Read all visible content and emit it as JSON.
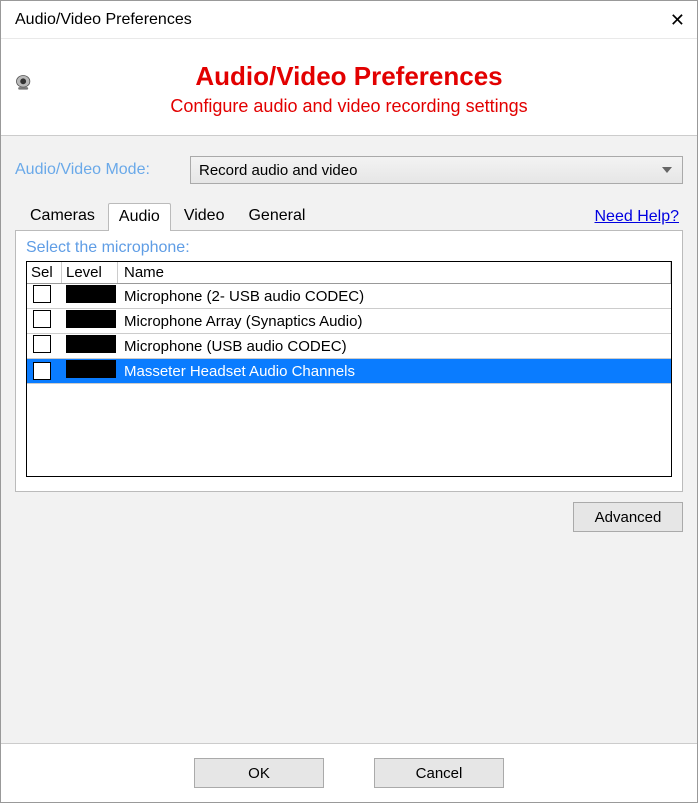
{
  "window": {
    "title": "Audio/Video Preferences"
  },
  "header": {
    "title": "Audio/Video Preferences",
    "subtitle": "Configure audio and video recording settings"
  },
  "mode": {
    "label": "Audio/Video Mode:",
    "value": "Record audio and video"
  },
  "tabs": [
    {
      "label": "Cameras",
      "active": false
    },
    {
      "label": "Audio",
      "active": true
    },
    {
      "label": "Video",
      "active": false
    },
    {
      "label": "General",
      "active": false
    }
  ],
  "helpLink": "Need Help?",
  "micSection": {
    "label": "Select the microphone:",
    "columns": {
      "sel": "Sel",
      "level": "Level",
      "name": "Name"
    },
    "rows": [
      {
        "checked": false,
        "name": "Microphone (2- USB audio CODEC)",
        "selected": false
      },
      {
        "checked": false,
        "name": "Microphone Array (Synaptics Audio)",
        "selected": false
      },
      {
        "checked": false,
        "name": "Microphone (USB audio CODEC)",
        "selected": false
      },
      {
        "checked": true,
        "name": "Masseter Headset Audio Channels",
        "selected": true
      }
    ]
  },
  "buttons": {
    "advanced": "Advanced",
    "ok": "OK",
    "cancel": "Cancel"
  }
}
